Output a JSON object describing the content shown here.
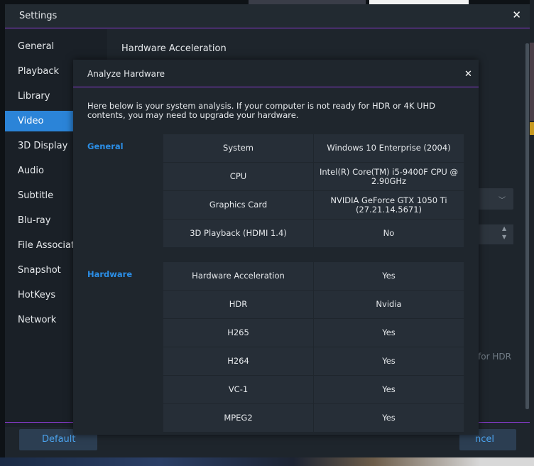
{
  "settings": {
    "title": "Settings",
    "close_glyph": "✕",
    "panel_title": "Hardware Acceleration",
    "sidebar_items": [
      {
        "label": "General"
      },
      {
        "label": "Playback"
      },
      {
        "label": "Library"
      },
      {
        "label": "Video"
      },
      {
        "label": "3D Display"
      },
      {
        "label": "Audio"
      },
      {
        "label": "Subtitle"
      },
      {
        "label": "Blu-ray"
      },
      {
        "label": "File Associati"
      },
      {
        "label": "Snapshot"
      },
      {
        "label": "HotKeys"
      },
      {
        "label": "Network"
      }
    ],
    "active_item": "Video",
    "partial_hdr_text": "for HDR",
    "default_button": "Default",
    "cancel_button": "ncel"
  },
  "dialog": {
    "title": "Analyze Hardware",
    "close_glyph": "✕",
    "description": "Here below is your system analysis. If your computer is not ready for HDR or 4K UHD contents, you may need to upgrade your hardware.",
    "general": {
      "label": "General",
      "rows": [
        {
          "key": "System",
          "value": "Windows 10 Enterprise (2004)"
        },
        {
          "key": "CPU",
          "value": "Intel(R) Core(TM) i5-9400F CPU @ 2.90GHz"
        },
        {
          "key": "Graphics Card",
          "value": "NVIDIA GeForce GTX 1050 Ti (27.21.14.5671)"
        },
        {
          "key": "3D Playback (HDMI 1.4)",
          "value": "No"
        }
      ]
    },
    "hardware": {
      "label": "Hardware",
      "rows": [
        {
          "key": "Hardware Acceleration",
          "value": "Yes"
        },
        {
          "key": "HDR",
          "value": "Nvidia"
        },
        {
          "key": "H265",
          "value": "Yes"
        },
        {
          "key": "H264",
          "value": "Yes"
        },
        {
          "key": "VC-1",
          "value": "Yes"
        },
        {
          "key": "MPEG2",
          "value": "Yes"
        }
      ]
    }
  },
  "colors": {
    "accent_blue": "#2b84d8",
    "divider_purple": "#8a3bd1",
    "section_blue": "#2b8ee6"
  }
}
